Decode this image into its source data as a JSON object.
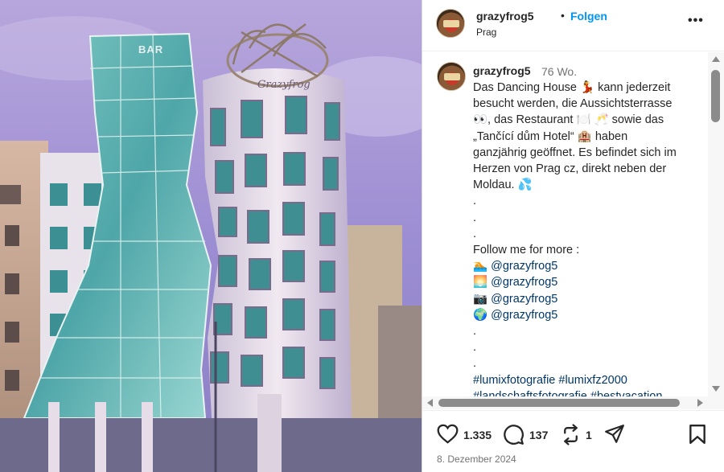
{
  "colors": {
    "accent": "#0095f6",
    "link": "#00376b",
    "text": "#262626",
    "muted": "#737373"
  },
  "photo": {
    "alt_icon": "dancing-house-photo",
    "sign_text": "BAR",
    "wordmark": "Grazyfrog"
  },
  "header": {
    "username": "grazyfrog5",
    "separator": "•",
    "follow_label": "Folgen",
    "location": "Prag",
    "more_icon": "more-options-icon",
    "more_glyph": "•••"
  },
  "caption": {
    "username": "grazyfrog5",
    "time": "76 Wo.",
    "lines": [
      "Das Dancing House 💃 kann jederzeit",
      "besucht werden, die Aussichtsterrasse",
      "👀, das Restaurant 🍽️ 🥂 sowie das",
      "„Tančící dům Hotel“ 🏨 haben",
      "ganzjährig geöffnet. Es befindet sich im",
      "Herzen von Prag cz, direkt neben der",
      "Moldau. 💦",
      ".",
      ".",
      ".",
      "Follow me for more :"
    ],
    "follow_rows": [
      {
        "icon": "🏊",
        "handle": "@grazyfrog5"
      },
      {
        "icon": "🌅",
        "handle": "@grazyfrog5"
      },
      {
        "icon": "📷",
        "handle": "@grazyfrog5"
      },
      {
        "icon": "🌍",
        "handle": "@grazyfrog5"
      }
    ],
    "after_dots": [
      ".",
      ".",
      "."
    ],
    "hashtags": [
      "#lumixfotografie #lumixfz2000",
      "#landschaftsfotografie #bestvacation"
    ]
  },
  "actions": {
    "likes": "1.335",
    "comments": "137",
    "reposts": "1"
  },
  "date": "8. Dezember 2024"
}
